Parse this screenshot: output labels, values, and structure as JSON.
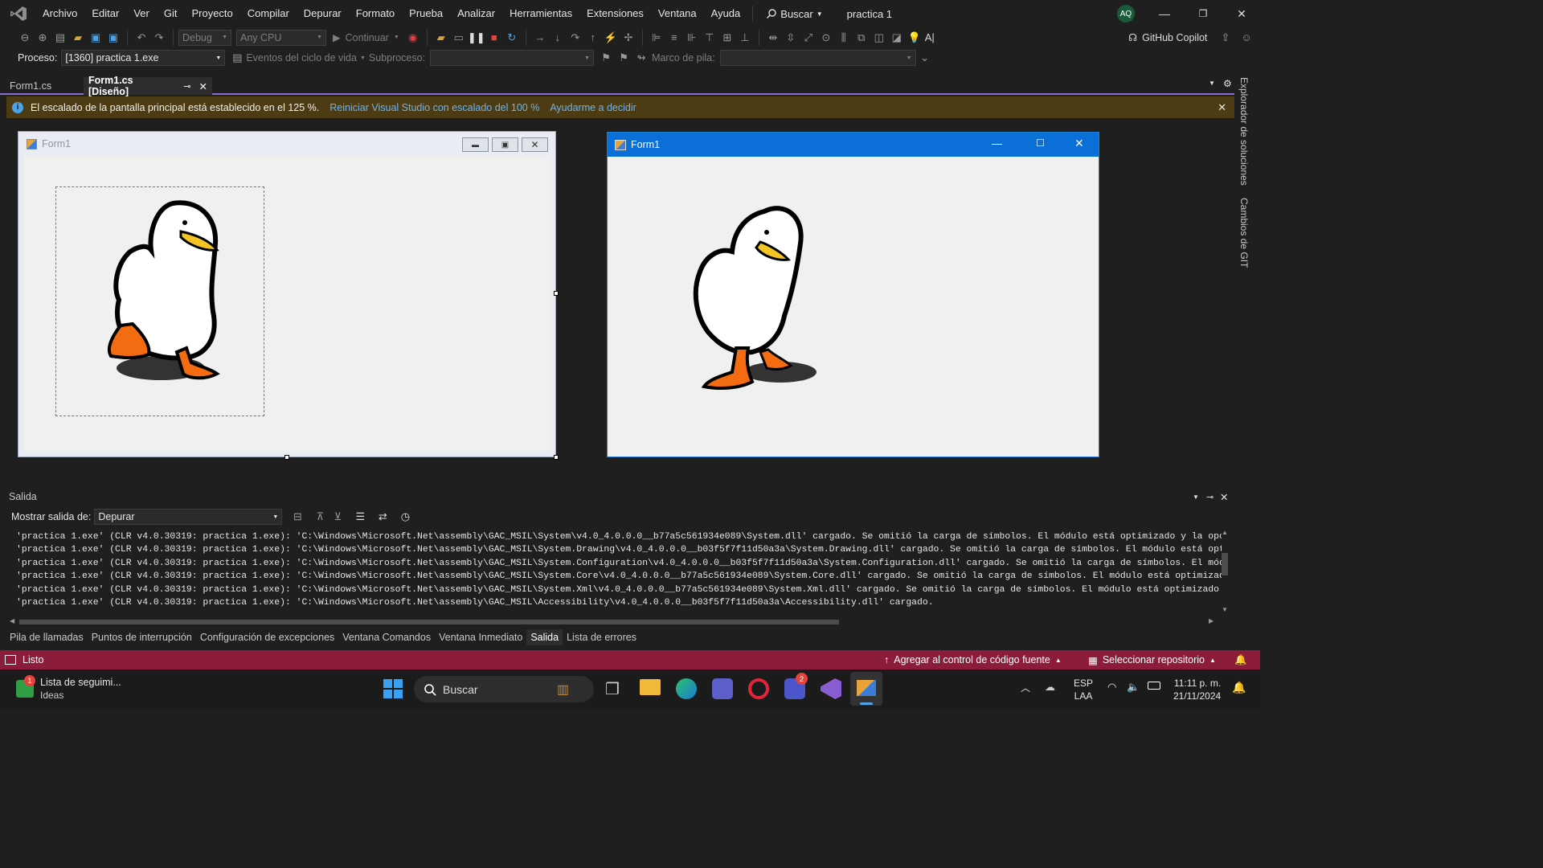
{
  "menubar": {
    "items": [
      "Archivo",
      "Editar",
      "Ver",
      "Git",
      "Proyecto",
      "Compilar",
      "Depurar",
      "Formato",
      "Prueba",
      "Analizar",
      "Herramientas",
      "Extensiones",
      "Ventana",
      "Ayuda"
    ],
    "search_label": "Buscar",
    "project_title": "practica 1",
    "avatar_initials": "AQ"
  },
  "toolbar": {
    "config": "Debug",
    "platform": "Any CPU",
    "continue_label": "Continuar",
    "copilot_label": "GitHub Copilot",
    "ai_label": "A|"
  },
  "toolbar2": {
    "process_label": "Proceso:",
    "process_value": "[1360] practica 1.exe",
    "lifecycle_label": "Eventos del ciclo de vida",
    "thread_label": "Subproceso:",
    "stackframe_label": "Marco de pila:"
  },
  "tabs": [
    {
      "label": "Form1.cs",
      "active": false
    },
    {
      "label": "Form1.cs [Diseño]",
      "active": true
    }
  ],
  "infobar": {
    "message": "El escalado de la pantalla principal está establecido en el 125 %.",
    "link1": "Reiniciar Visual Studio con escalado del 100 %",
    "link2": "Ayudarme a decidir"
  },
  "design_form": {
    "title": "Form1"
  },
  "run_form": {
    "title": "Form1"
  },
  "output": {
    "title": "Salida",
    "show_label": "Mostrar salida de:",
    "source": "Depurar",
    "lines": [
      "'practica 1.exe' (CLR v4.0.30319: practica 1.exe): 'C:\\Windows\\Microsoft.Net\\assembly\\GAC_MSIL\\System\\v4.0_4.0.0.0__b77a5c561934e089\\System.dll' cargado. Se omitió la carga de símbolos. El módulo está optimizado y la opción del d",
      "'practica 1.exe' (CLR v4.0.30319: practica 1.exe): 'C:\\Windows\\Microsoft.Net\\assembly\\GAC_MSIL\\System.Drawing\\v4.0_4.0.0.0__b03f5f7f11d50a3a\\System.Drawing.dll' cargado. Se omitió la carga de símbolos. El módulo está optimizado y",
      "'practica 1.exe' (CLR v4.0.30319: practica 1.exe): 'C:\\Windows\\Microsoft.Net\\assembly\\GAC_MSIL\\System.Configuration\\v4.0_4.0.0.0__b03f5f7f11d50a3a\\System.Configuration.dll' cargado. Se omitió la carga de símbolos. El módulo está",
      "'practica 1.exe' (CLR v4.0.30319: practica 1.exe): 'C:\\Windows\\Microsoft.Net\\assembly\\GAC_MSIL\\System.Core\\v4.0_4.0.0.0__b77a5c561934e089\\System.Core.dll' cargado. Se omitió la carga de símbolos. El módulo está optimizado y la op",
      "'practica 1.exe' (CLR v4.0.30319: practica 1.exe): 'C:\\Windows\\Microsoft.Net\\assembly\\GAC_MSIL\\System.Xml\\v4.0_4.0.0.0__b77a5c561934e089\\System.Xml.dll' cargado. Se omitió la carga de símbolos. El módulo está optimizado y la opci",
      "'practica 1.exe' (CLR v4.0.30319: practica 1.exe): 'C:\\Windows\\Microsoft.Net\\assembly\\GAC_MSIL\\Accessibility\\v4.0_4.0.0.0__b03f5f7f11d50a3a\\Accessibility.dll' cargado."
    ]
  },
  "bottom_tabs": [
    "Pila de llamadas",
    "Puntos de interrupción",
    "Configuración de excepciones",
    "Ventana Comandos",
    "Ventana Inmediato",
    "Salida",
    "Lista de errores"
  ],
  "side_panels": [
    "Explorador de soluciones",
    "Cambios de GIT"
  ],
  "status": {
    "ready": "Listo",
    "source_control": "Agregar al control de código fuente",
    "repo": "Seleccionar repositorio"
  },
  "taskbar": {
    "widget_title": "Lista de seguimi...",
    "widget_sub": "Ideas",
    "widget_badge": "1",
    "search_label": "Buscar",
    "teams_badge": "2",
    "lang": "ESP",
    "lang_sub": "LAA",
    "time": "11:11 p. m.",
    "date": "21/11/2024"
  },
  "colors": {
    "accent_purple": "#8a6fd1",
    "infobar_bg": "#4d3c13",
    "status_bg": "#8b1c3a",
    "link": "#6cb4f0",
    "run_titlebar": "#0a6fd6"
  }
}
